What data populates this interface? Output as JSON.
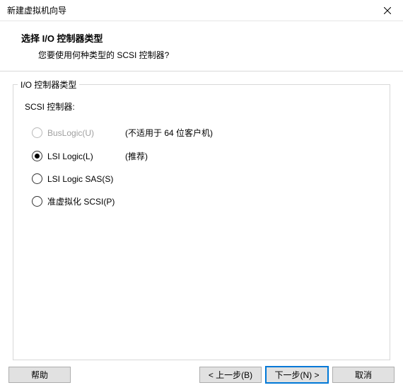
{
  "titlebar": {
    "title": "新建虚拟机向导"
  },
  "header": {
    "title": "选择 I/O 控制器类型",
    "subtitle": "您要使用何种类型的 SCSI 控制器?"
  },
  "fieldset": {
    "legend": "I/O 控制器类型",
    "scsi_label": "SCSI 控制器:"
  },
  "options": [
    {
      "label": "BusLogic(U)",
      "hint": "(不适用于 64 位客户机)",
      "disabled": true,
      "selected": false
    },
    {
      "label": "LSI Logic(L)",
      "hint": "(推荐)",
      "disabled": false,
      "selected": true
    },
    {
      "label": "LSI Logic SAS(S)",
      "hint": "",
      "disabled": false,
      "selected": false
    },
    {
      "label": "准虚拟化 SCSI(P)",
      "hint": "",
      "disabled": false,
      "selected": false
    }
  ],
  "buttons": {
    "help": "帮助",
    "back": "< 上一步(B)",
    "next": "下一步(N) >",
    "cancel": "取消"
  }
}
